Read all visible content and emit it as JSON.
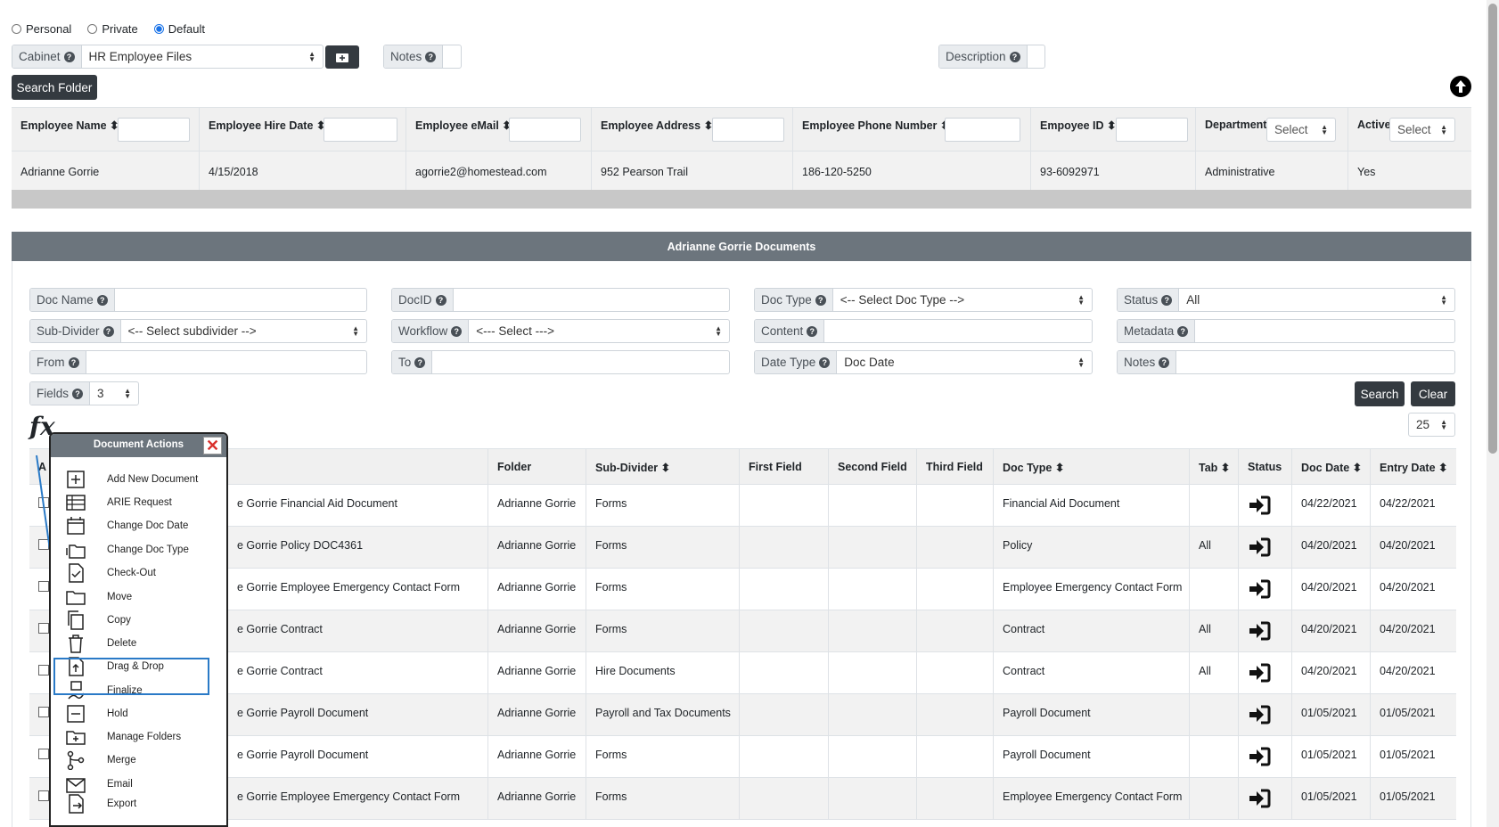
{
  "visibility": {
    "options": [
      "Personal",
      "Private",
      "Default"
    ],
    "selected": "Default"
  },
  "cabinet": {
    "label": "Cabinet",
    "value": "HR Employee Files"
  },
  "notes_label": "Notes",
  "description_label": "Description",
  "search_folder_label": "Search Folder",
  "employee_table": {
    "headers": [
      "Employee Name",
      "Employee Hire Date",
      "Employee eMail",
      "Employee Address",
      "Employee Phone Number",
      "Empoyee ID",
      "Department",
      "Active"
    ],
    "department_select": "Select",
    "active_select": "Select",
    "row": [
      "Adrianne Gorrie",
      "4/15/2018",
      "agorrie2@homestead.com",
      "952 Pearson Trail",
      "186-120-5250",
      "93-6092971",
      "Administrative",
      "Yes"
    ]
  },
  "documents": {
    "title": "Adrianne Gorrie Documents",
    "filters": {
      "doc_name": "Doc Name",
      "docid": "DocID",
      "doc_type": "Doc Type",
      "doc_type_value": "<-- Select Doc Type -->",
      "status": "Status",
      "status_value": "All",
      "sub_divider": "Sub-Divider",
      "sub_divider_value": "<-- Select subdivider -->",
      "workflow": "Workflow",
      "workflow_value": "<--- Select --->",
      "content": "Content",
      "metadata": "Metadata",
      "from": "From",
      "to": "To",
      "date_type": "Date Type",
      "date_type_value": "Doc Date",
      "notes": "Notes",
      "fields": "Fields",
      "fields_value": "3"
    },
    "search_label": "Search",
    "clear_label": "Clear",
    "page_size": "25",
    "fx": "fx",
    "columns": [
      "A",
      "",
      "Folder",
      "Sub-Divider",
      "First Field",
      "Second Field",
      "Third Field",
      "Doc Type",
      "Tab",
      "Status",
      "Doc Date",
      "Entry Date"
    ],
    "rows": [
      {
        "name": "e Gorrie Financial Aid Document",
        "folder": "Adrianne Gorrie",
        "sub": "Forms",
        "type": "Financial Aid Document",
        "tab": "",
        "doc_date": "04/22/2021",
        "entry_date": "04/22/2021"
      },
      {
        "name": "e Gorrie Policy DOC4361",
        "folder": "Adrianne Gorrie",
        "sub": "Forms",
        "type": "Policy",
        "tab": "All",
        "doc_date": "04/20/2021",
        "entry_date": "04/20/2021"
      },
      {
        "name": "e Gorrie Employee Emergency Contact Form",
        "folder": "Adrianne Gorrie",
        "sub": "Forms",
        "type": "Employee Emergency Contact Form",
        "tab": "",
        "doc_date": "04/20/2021",
        "entry_date": "04/20/2021"
      },
      {
        "name": "e Gorrie Contract",
        "folder": "Adrianne Gorrie",
        "sub": "Forms",
        "type": "Contract",
        "tab": "All",
        "doc_date": "04/20/2021",
        "entry_date": "04/20/2021"
      },
      {
        "name": "e Gorrie Contract",
        "folder": "Adrianne Gorrie",
        "sub": "Hire Documents",
        "type": "Contract",
        "tab": "All",
        "doc_date": "04/20/2021",
        "entry_date": "04/20/2021"
      },
      {
        "name": "e Gorrie Payroll Document",
        "folder": "Adrianne Gorrie",
        "sub": "Payroll and Tax Documents",
        "type": "Payroll Document",
        "tab": "",
        "doc_date": "01/05/2021",
        "entry_date": "01/05/2021"
      },
      {
        "name": "e Gorrie Payroll Document",
        "folder": "Adrianne Gorrie",
        "sub": "Forms",
        "type": "Payroll Document",
        "tab": "",
        "doc_date": "01/05/2021",
        "entry_date": "01/05/2021"
      },
      {
        "name": "e Gorrie Employee Emergency Contact Form",
        "folder": "Adrianne Gorrie",
        "sub": "Forms",
        "type": "Employee Emergency Contact Form",
        "tab": "",
        "doc_date": "01/05/2021",
        "entry_date": "01/05/2021"
      }
    ]
  },
  "popup": {
    "title": "Document Actions",
    "items": [
      {
        "label": "Add New Document",
        "icon": "plus-square-icon"
      },
      {
        "label": "ARIE Request",
        "icon": "table-icon"
      },
      {
        "label": "Change Doc Date",
        "icon": "calendar-icon"
      },
      {
        "label": "Change Doc Type",
        "icon": "folders-icon"
      },
      {
        "label": "Check-Out",
        "icon": "check-file-icon"
      },
      {
        "label": "Move",
        "icon": "folder-icon"
      },
      {
        "label": "Copy",
        "icon": "copy-icon"
      },
      {
        "label": "Delete",
        "icon": "trash-icon"
      },
      {
        "label": "Drag & Drop",
        "icon": "upload-file-icon"
      },
      {
        "label": "Finalize",
        "icon": "finalize-icon"
      },
      {
        "label": "Hold",
        "icon": "minus-square-icon"
      },
      {
        "label": "Manage Folders",
        "icon": "folder-plus-icon"
      },
      {
        "label": "Merge",
        "icon": "merge-icon"
      },
      {
        "label": "Email",
        "icon": "email-icon"
      },
      {
        "label": "Export",
        "icon": "export-icon"
      }
    ],
    "highlighted": "Drag & Drop"
  }
}
